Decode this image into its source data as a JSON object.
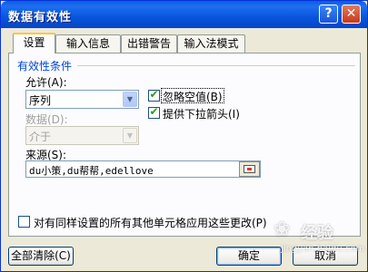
{
  "window": {
    "title": "数据有效性",
    "help_glyph": "?",
    "close_glyph": "✕"
  },
  "tabs": [
    {
      "label": "设置",
      "active": true
    },
    {
      "label": "输入信息",
      "active": false
    },
    {
      "label": "出错警告",
      "active": false
    },
    {
      "label": "输入法模式",
      "active": false
    }
  ],
  "settings": {
    "group_label": "有效性条件",
    "allow": {
      "label": "允许(A):",
      "value": "序列"
    },
    "ignore_blank": {
      "label": "忽略空值(B)",
      "checked": true
    },
    "in_cell_dropdown": {
      "label": "提供下拉箭头(I)",
      "checked": true
    },
    "data": {
      "label": "数据(D):",
      "value": "介于",
      "enabled": false
    },
    "source": {
      "label": "来源(S):",
      "value": "du小策,du帮帮,edellove"
    },
    "apply_all": {
      "label": "对有同样设置的所有其他单元格应用这些更改(P)",
      "checked": false
    }
  },
  "buttons": {
    "clear_all": "全部清除(C)",
    "ok": "确定",
    "cancel": "取消"
  },
  "watermark": {
    "name": "经验",
    "url": "jingyan.baidu.com"
  },
  "icons": {
    "checkmark": "✔",
    "dropdown": "▼",
    "paw": "❀"
  },
  "colors": {
    "titlebar": "#0a5ce6",
    "dialog_bg": "#ece9d8",
    "group_label": "#0046d5",
    "close_button": "#c9381d"
  }
}
